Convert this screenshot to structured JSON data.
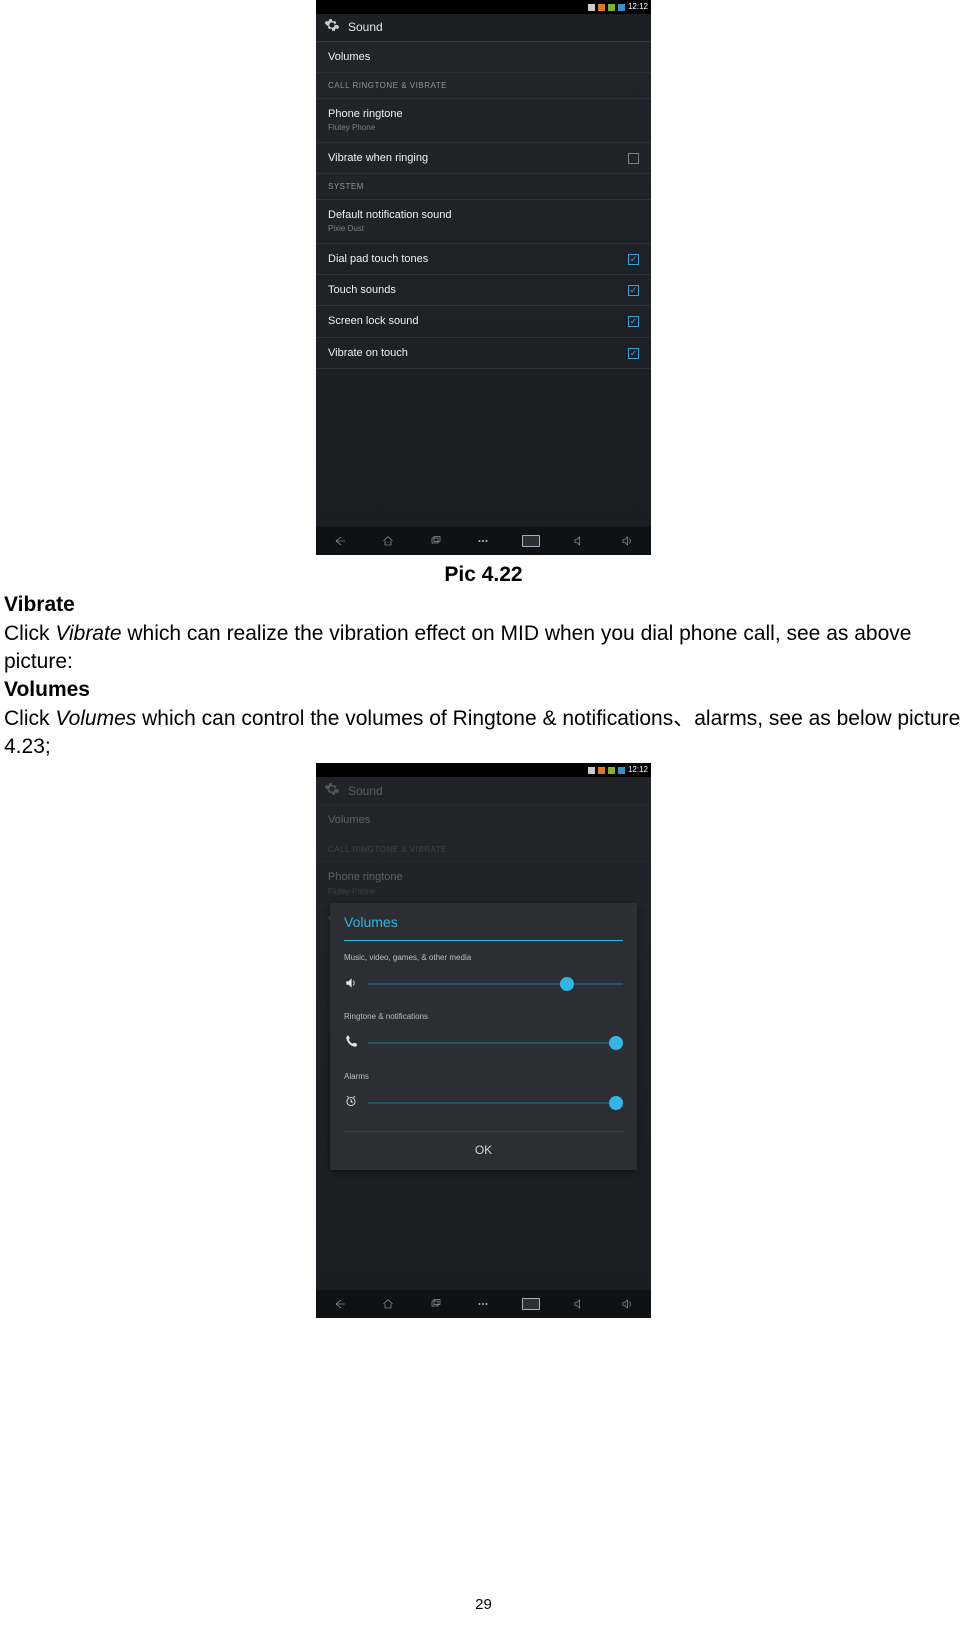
{
  "screen1": {
    "status": {
      "time": "12:12"
    },
    "title": "Sound",
    "rows": {
      "volumes": "Volumes",
      "sect1": "CALL RINGTONE & VIBRATE",
      "phone_ringtone": "Phone ringtone",
      "phone_ringtone_sub": "Flutey Phone",
      "vibrate_ringing": "Vibrate when ringing",
      "sect2": "SYSTEM",
      "default_notif": "Default notification sound",
      "default_notif_sub": "Pixie Dust",
      "dial_pad": "Dial pad touch tones",
      "touch_sounds": "Touch sounds",
      "screen_lock": "Screen lock sound",
      "vibrate_touch": "Vibrate on touch"
    }
  },
  "caption1": "Pic 4.22",
  "doc": {
    "h1": "Vibrate",
    "p1a": "Click ",
    "p1b": "Vibrate",
    "p1c": " which can realize the vibration effect on MID when you dial phone call, see as above picture:",
    "h2": "Volumes",
    "p2a": "Click ",
    "p2b": "Volumes",
    "p2c": " which can control the volumes of    Ringtone & notifications、alarms, see as below picture 4.23;"
  },
  "screen2": {
    "status": {
      "time": "12:12"
    },
    "title": "Sound",
    "rows": {
      "volumes": "Volumes",
      "sect1": "CALL RINGTONE & VIBRATE",
      "phone_ringtone": "Phone ringtone",
      "phone_ringtone_sub": "Flutey Phone",
      "vibrate_ringing": "Vibrate when ringing"
    },
    "dialog": {
      "title": "Volumes",
      "slider1_label": "Music, video, games, & other media",
      "slider2_label": "Ringtone & notifications",
      "slider3_label": "Alarms",
      "ok": "OK"
    }
  },
  "pagenum": "29"
}
